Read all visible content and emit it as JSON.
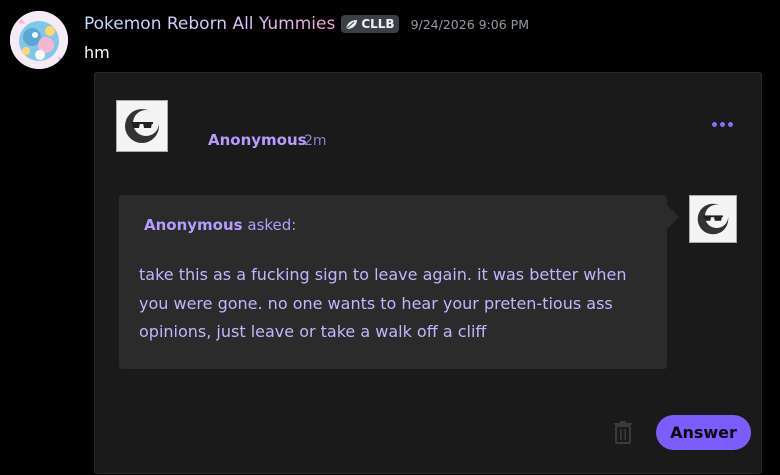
{
  "message": {
    "author": "Pokemon Reborn All Yummies",
    "tag": {
      "icon": "leaf-icon",
      "label": "CLLB"
    },
    "timestamp": "9/24/2026 9:06 PM",
    "content": "hm"
  },
  "post": {
    "author": "Anonymous",
    "age": "2m",
    "menu_icon": "ellipsis-icon"
  },
  "ask": {
    "asker": "Anonymous",
    "asked_label": "asked:",
    "question": "take this as a fucking sign to leave again. it was better when you were gone. no one wants to hear your preten-tious ass opinions, just leave or take a walk off a cliff"
  },
  "actions": {
    "delete_icon": "trash-icon",
    "answer_label": "Answer"
  },
  "colors": {
    "accent": "#7b5cff",
    "author_text": "#b59cff",
    "question_text": "#c4b4ff",
    "background": "#000000",
    "embed_background": "#1a1a1a",
    "bubble_background": "#2b2b2b"
  }
}
